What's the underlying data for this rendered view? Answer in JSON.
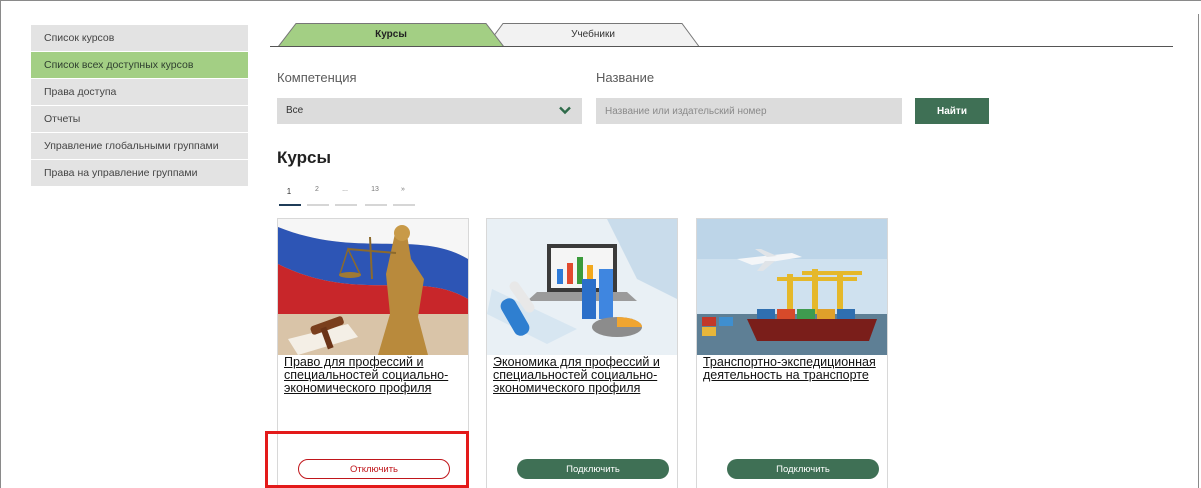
{
  "sidebar": {
    "items": [
      {
        "label": "Список курсов",
        "active": false
      },
      {
        "label": "Список всех доступных курсов",
        "active": true
      },
      {
        "label": "Права доступа",
        "active": false
      },
      {
        "label": "Отчеты",
        "active": false
      },
      {
        "label": "Управление глобальными группами",
        "active": false
      },
      {
        "label": "Права на управление группами",
        "active": false
      }
    ]
  },
  "tabs": [
    {
      "label": "Курсы",
      "active": true
    },
    {
      "label": "Учебники",
      "active": false
    }
  ],
  "filters": {
    "competence_label": "Компетенция",
    "competence_value": "Все",
    "name_label": "Название",
    "name_placeholder": "Название или издательский номер",
    "find_label": "Найти"
  },
  "section_title": "Курсы",
  "pagination": {
    "pages": [
      "1",
      "2",
      "...",
      "13",
      "»"
    ],
    "current": "1"
  },
  "courses": [
    {
      "title": "Право для профессий и специальностей социально-экономического профиля",
      "button": "Отключить",
      "connected": true,
      "image": "justice-statue-image"
    },
    {
      "title": "Экономика для профессий и специальностей социально-экономического профиля",
      "button": "Подключить",
      "connected": false,
      "image": "economics-laptop-image"
    },
    {
      "title": "Транспортно-экспедиционная деятельность на транспорте",
      "button": "Подключить",
      "connected": false,
      "image": "transport-port-image"
    }
  ],
  "colors": {
    "accent_green": "#3f7055",
    "sidebar_active": "#a3cf84",
    "highlight_red": "#e31a1a"
  }
}
